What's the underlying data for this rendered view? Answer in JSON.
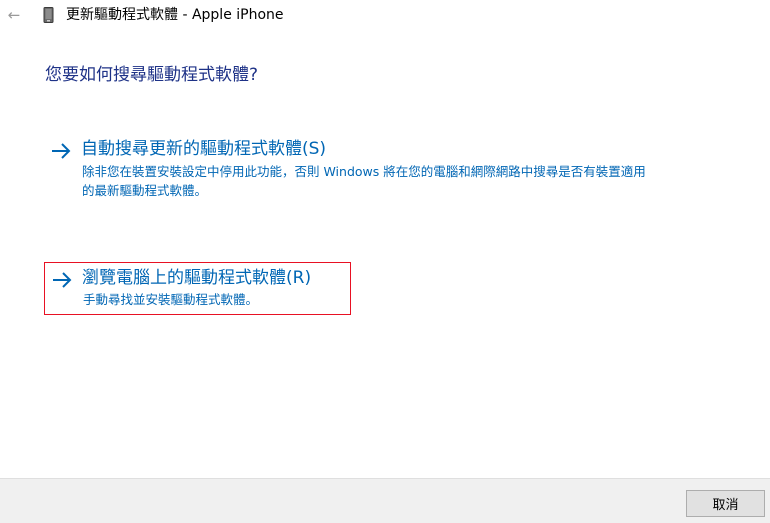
{
  "titlebar": {
    "back_icon": "back-arrow-icon",
    "device_icon": "device-icon",
    "title": "更新驅動程式軟體 - Apple iPhone"
  },
  "main": {
    "heading": "您要如何搜尋驅動程式軟體?",
    "options": [
      {
        "icon": "arrow-right-icon",
        "label": "自動搜尋更新的驅動程式軟體(S)",
        "description": "除非您在裝置安裝設定中停用此功能，否則 Windows 將在您的電腦和網際網路中搜尋是否有裝置適用的最新驅動程式軟體。"
      },
      {
        "icon": "arrow-right-icon",
        "label": "瀏覽電腦上的驅動程式軟體(R)",
        "description": "手動尋找並安裝驅動程式軟體。"
      }
    ]
  },
  "footer": {
    "cancel_label": "取消"
  },
  "colors": {
    "link": "#0066b4",
    "heading": "#1e3287",
    "focus_border": "#e81123",
    "footer_bg": "#f0f0f0"
  }
}
